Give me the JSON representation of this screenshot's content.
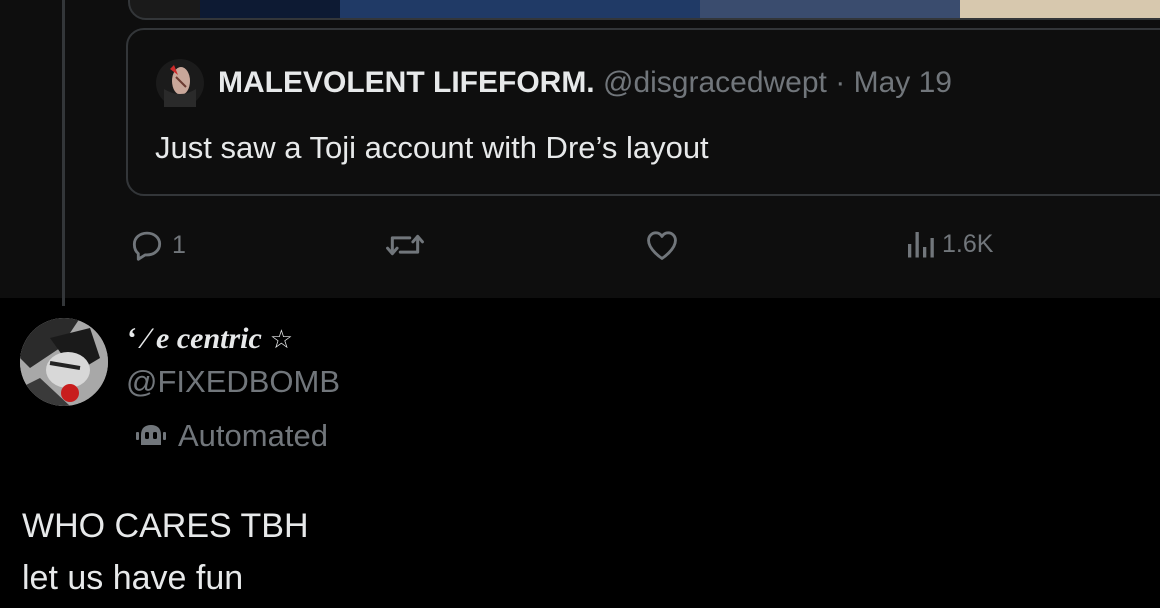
{
  "quoted_tweet": {
    "author_name": "MALEVOLENT LIFEFORM.",
    "author_handle": "@disgracedwept",
    "separator": "·",
    "date": "May 19",
    "text": "Just saw a Toji account with Dre’s layout"
  },
  "actions": {
    "reply_count": "1",
    "views_count": "1.6K",
    "icons": [
      "reply-icon",
      "retweet-icon",
      "like-icon",
      "views-icon"
    ]
  },
  "reply": {
    "display_name": "‘ ⁄ e   centric",
    "name_badge": "☆",
    "handle": "@FIXEDBOMB",
    "automated_label": "Automated",
    "text_lines": [
      "WHO CARES TBH",
      "let us have fun"
    ]
  },
  "colors": {
    "background": "#000000",
    "text_primary": "#e7e9ea",
    "text_secondary": "#71767b",
    "border": "#333639"
  }
}
